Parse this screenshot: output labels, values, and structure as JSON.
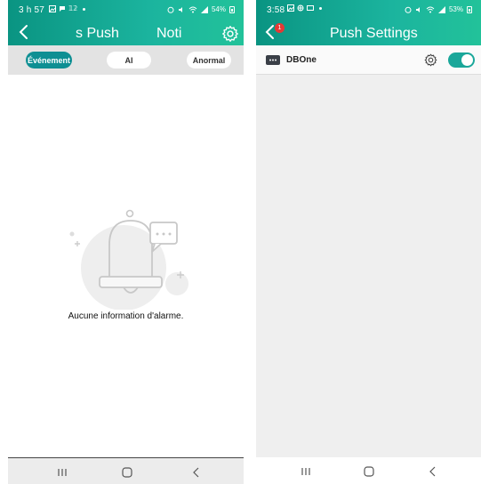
{
  "left": {
    "status": {
      "time": "3 h 57",
      "left_extra": "𝟙𝟚",
      "battery": "54%"
    },
    "header": {
      "title_part1": "s Push",
      "title_part2": "Noti"
    },
    "filters": [
      {
        "label": "Événement",
        "active": true
      },
      {
        "label": "AI",
        "active": false
      },
      {
        "label": "Anormal",
        "active": false
      }
    ],
    "empty_message": "Aucune information d'alarme."
  },
  "right": {
    "status": {
      "time": "3:58",
      "battery": "53%"
    },
    "header": {
      "title": "Push Settings",
      "back_badge": "1"
    },
    "devices": [
      {
        "name": "DBOne",
        "enabled": true
      }
    ]
  },
  "colors": {
    "header_start": "#0a9482",
    "header_end": "#22c29a",
    "accent": "#1aa79a",
    "active_chip": "#0e8f93",
    "badge": "#e53935"
  },
  "icons": [
    "back-arrow-icon",
    "gear-icon",
    "bell-icon",
    "chat-bubble-icon",
    "camera-device-icon",
    "recent-apps-icon",
    "home-icon",
    "nav-back-icon"
  ]
}
